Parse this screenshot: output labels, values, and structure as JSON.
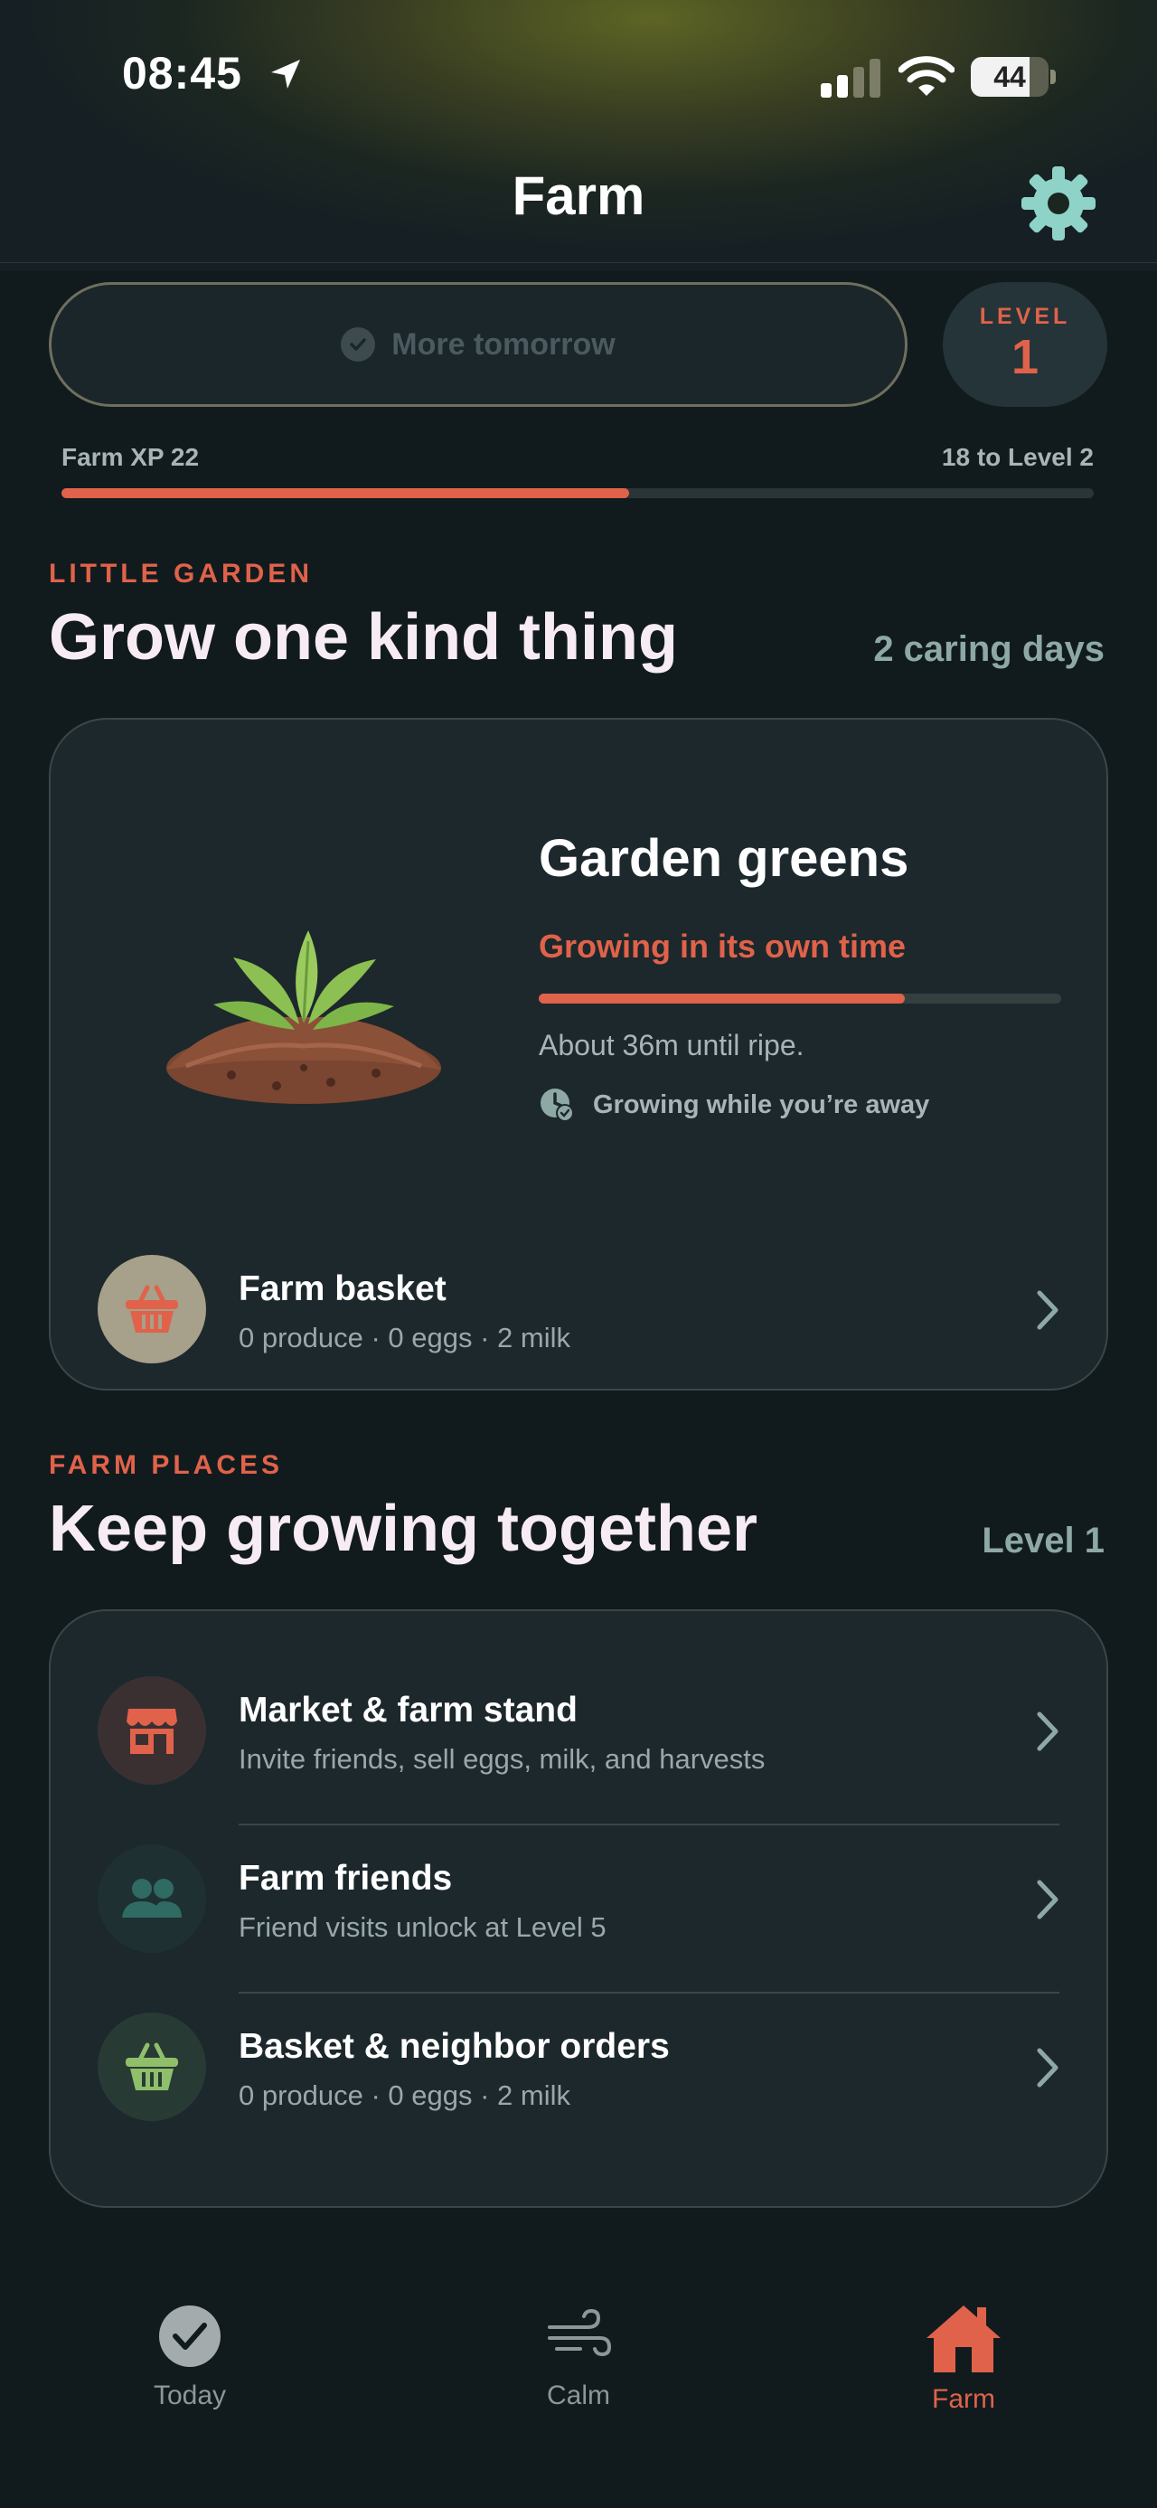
{
  "status_bar": {
    "time": "08:45",
    "battery": "44"
  },
  "header": {
    "title": "Farm"
  },
  "daily": {
    "button_label": "More tomorrow",
    "level_label": "LEVEL",
    "level_value": "1"
  },
  "xp": {
    "left_label": "Farm XP 22",
    "right_label": "18 to Level 2",
    "progress": 0.55
  },
  "garden": {
    "eyebrow": "LITTLE GARDEN",
    "title": "Grow one kind thing",
    "caring_days": "2 caring days",
    "crop_name": "Garden greens",
    "crop_status": "Growing in its own time",
    "crop_progress": 0.7,
    "eta": "About 36m until ripe.",
    "away_note": "Growing while you’re away",
    "basket": {
      "title": "Farm basket",
      "subtitle": "0 produce · 0 eggs · 2 milk"
    }
  },
  "places": {
    "eyebrow": "FARM PLACES",
    "title": "Keep growing together",
    "level": "Level 1",
    "items": [
      {
        "title": "Market & farm stand",
        "subtitle": "Invite friends, sell eggs, milk, and harvests",
        "icon": "storefront-icon"
      },
      {
        "title": "Farm friends",
        "subtitle": "Friend visits unlock at Level 5",
        "icon": "people-icon"
      },
      {
        "title": "Basket & neighbor orders",
        "subtitle": "0 produce · 0 eggs · 2 milk",
        "icon": "basket-icon"
      }
    ]
  },
  "tabs": [
    {
      "label": "Today",
      "icon": "checkmark-circle-icon"
    },
    {
      "label": "Calm",
      "icon": "wind-icon"
    },
    {
      "label": "Farm",
      "icon": "house-icon",
      "active": true
    }
  ],
  "colors": {
    "accent": "#e0624a",
    "background": "#111b1e",
    "card": "#1c282c",
    "muted": "#8ea8a6"
  }
}
